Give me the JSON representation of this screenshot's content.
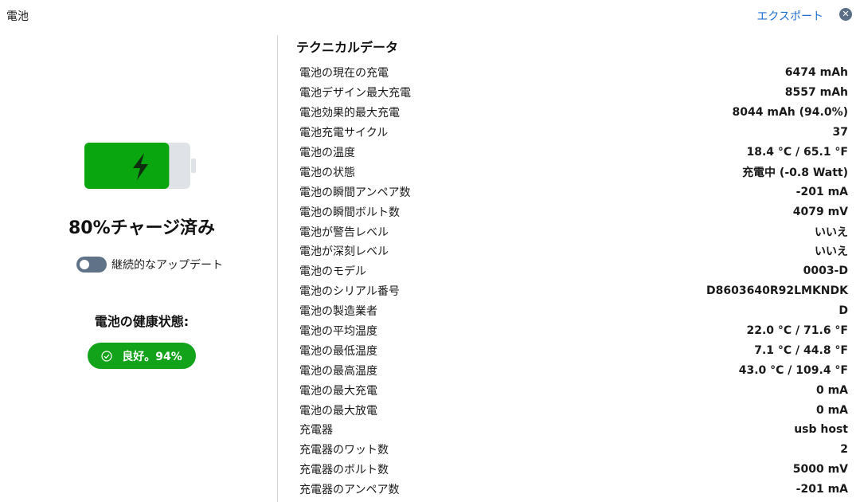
{
  "window": {
    "title": "電池",
    "export_label": "エクスポート",
    "close_glyph": "✕"
  },
  "left": {
    "charge_percent": 80,
    "charge_text": "80%チャージ済み",
    "toggle_label": "継続的なアップデート",
    "toggle_on": false,
    "health_heading": "電池の健康状態:",
    "health_badge": "良好。94%",
    "colors": {
      "battery_fill": "#0aa60f",
      "battery_empty": "#dfe3e7",
      "badge": "#12a31b",
      "toggle": "#5f7287",
      "link": "#1f6fd1"
    },
    "icons": [
      "lightning-icon",
      "check-circle-icon",
      "close-icon"
    ]
  },
  "tech": {
    "title": "テクニカルデータ",
    "rows": [
      {
        "label": "電池の現在の充電",
        "value": "6474 mAh"
      },
      {
        "label": "電池デザイン最大充電",
        "value": "8557 mAh"
      },
      {
        "label": "電池効果的最大充電",
        "value": "8044 mAh (94.0%)"
      },
      {
        "label": "電池充電サイクル",
        "value": "37"
      },
      {
        "label": "電池の温度",
        "value": "18.4 °C / 65.1 °F"
      },
      {
        "label": "電池の状態",
        "value": "充電中 (-0.8 Watt)"
      },
      {
        "label": "電池の瞬間アンペア数",
        "value": "-201 mA"
      },
      {
        "label": "電池の瞬間ボルト数",
        "value": "4079 mV"
      },
      {
        "label": "電池が警告レベル",
        "value": "いいえ"
      },
      {
        "label": "電池が深刻レベル",
        "value": "いいえ"
      },
      {
        "label": "電池のモデル",
        "value": "0003-D"
      },
      {
        "label": "電池のシリアル番号",
        "value": "D8603640R92LMKNDK"
      },
      {
        "label": "電池の製造業者",
        "value": "D"
      },
      {
        "label": "電池の平均温度",
        "value": "22.0 °C / 71.6 °F"
      },
      {
        "label": "電池の最低温度",
        "value": "7.1 °C / 44.8 °F"
      },
      {
        "label": "電池の最高温度",
        "value": "43.0 °C / 109.4 °F"
      },
      {
        "label": "電池の最大充電",
        "value": "0 mA"
      },
      {
        "label": "電池の最大放電",
        "value": "0 mA"
      },
      {
        "label": "充電器",
        "value": "usb host"
      },
      {
        "label": "充電器のワット数",
        "value": "2"
      },
      {
        "label": "充電器のボルト数",
        "value": "5000 mV"
      },
      {
        "label": "充電器のアンペア数",
        "value": "-201 mA"
      }
    ]
  }
}
